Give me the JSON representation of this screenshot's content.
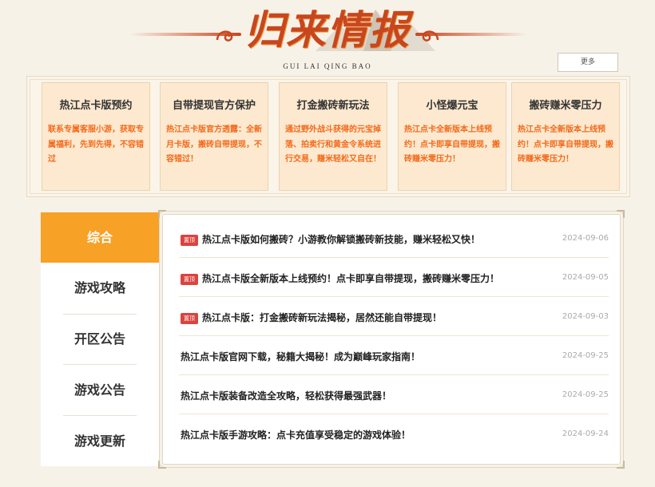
{
  "header": {
    "title": "归来情报",
    "subtitle": "GUI  LAI  QING  BAO",
    "more_label": "更多"
  },
  "cards": [
    {
      "title": "热江点卡版预约",
      "desc": "联系专属客服小游，获取专属福利，先到先得，不容错过"
    },
    {
      "title": "自带提现官方保护",
      "desc": "热江点卡版官方透露：全新月卡版，搬砖自带提现，不容错过！"
    },
    {
      "title": "打金搬砖新玩法",
      "desc": "通过野外战斗获得的元宝掉落、拍卖行和黄金令系统进行交易，赚米轻松又自在！"
    },
    {
      "title": "小怪爆元宝",
      "desc": "热江点卡全新版本上线预约！点卡即享自带提现，搬砖赚米零压力！"
    },
    {
      "title": "搬砖赚米零压力",
      "desc": "热江点卡全新版本上线预约！点卡即享自带提现，搬砖赚米零压力！"
    }
  ],
  "sidebar": {
    "items": [
      {
        "label": "综合",
        "active": true
      },
      {
        "label": "游戏攻略",
        "active": false
      },
      {
        "label": "开区公告",
        "active": false
      },
      {
        "label": "游戏公告",
        "active": false
      },
      {
        "label": "游戏更新",
        "active": false
      }
    ]
  },
  "news": {
    "pin_label": "置顶",
    "items": [
      {
        "title": "热江点卡版如何搬砖？小游教你解锁搬砖新技能，赚米轻松又快！",
        "date": "2024-09-06",
        "pinned": true
      },
      {
        "title": "热江点卡版全新版本上线预约！点卡即享自带提现，搬砖赚米零压力！",
        "date": "2024-09-05",
        "pinned": true
      },
      {
        "title": "热江点卡版：打金搬砖新玩法揭秘，居然还能自带提现！",
        "date": "2024-09-03",
        "pinned": true
      },
      {
        "title": "热江点卡版官网下载，秘籍大揭秘！成为巅峰玩家指南！",
        "date": "2024-09-25",
        "pinned": false
      },
      {
        "title": "热江点卡版装备改造全攻略，轻松获得最强武器！",
        "date": "2024-09-25",
        "pinned": false
      },
      {
        "title": "热江点卡版手游攻略：点卡充值享受稳定的游戏体验！",
        "date": "2024-09-24",
        "pinned": false
      }
    ]
  },
  "colors": {
    "accent": "#f7a126",
    "title_red": "#c8461e",
    "card_text": "#f26a1b",
    "pin_red": "#d9443f",
    "card_bg": "#fde9cf",
    "page_bg": "#f7f2e8"
  }
}
